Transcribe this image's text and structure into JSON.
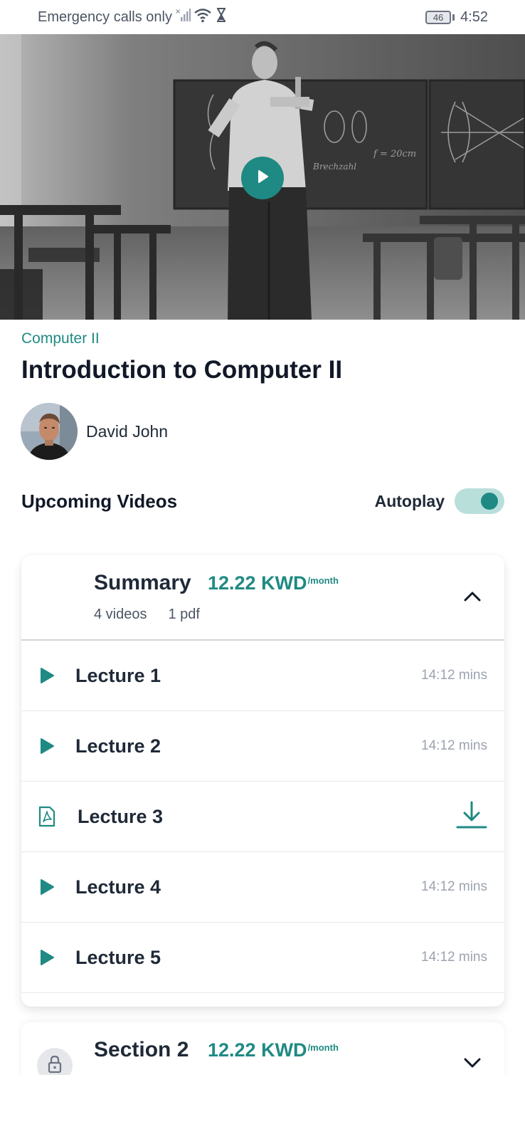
{
  "status_bar": {
    "carrier_text": "Emergency calls only",
    "battery_level": "46",
    "time": "4:52"
  },
  "hero": {
    "play_icon": "play-icon"
  },
  "course": {
    "category": "Computer II",
    "title": "Introduction to Computer II",
    "instructor_name": "David John"
  },
  "upcoming": {
    "title": "Upcoming Videos",
    "autoplay_label": "Autoplay",
    "autoplay_on": true
  },
  "sections": [
    {
      "name": "Summary",
      "price": "12.22 KWD",
      "price_unit": "/month",
      "videos": "4 videos",
      "pdfs": "1 pdf",
      "expanded": true,
      "lectures": [
        {
          "title": "Lecture 1",
          "type": "video",
          "duration": "14:12 mins"
        },
        {
          "title": "Lecture 2",
          "type": "video",
          "duration": "14:12 mins"
        },
        {
          "title": "Lecture 3",
          "type": "pdf",
          "duration": ""
        },
        {
          "title": "Lecture 4",
          "type": "video",
          "duration": "14:12 mins"
        },
        {
          "title": "Lecture 5",
          "type": "video",
          "duration": "14:12 mins"
        }
      ]
    },
    {
      "name": "Section 2",
      "price": "12.22 KWD",
      "price_unit": "/month",
      "locked": true,
      "expanded": false
    }
  ],
  "colors": {
    "accent": "#1f8a83",
    "accent_light": "#b9dfdb",
    "text_dark": "#111827",
    "text_muted": "#9ca3af"
  }
}
